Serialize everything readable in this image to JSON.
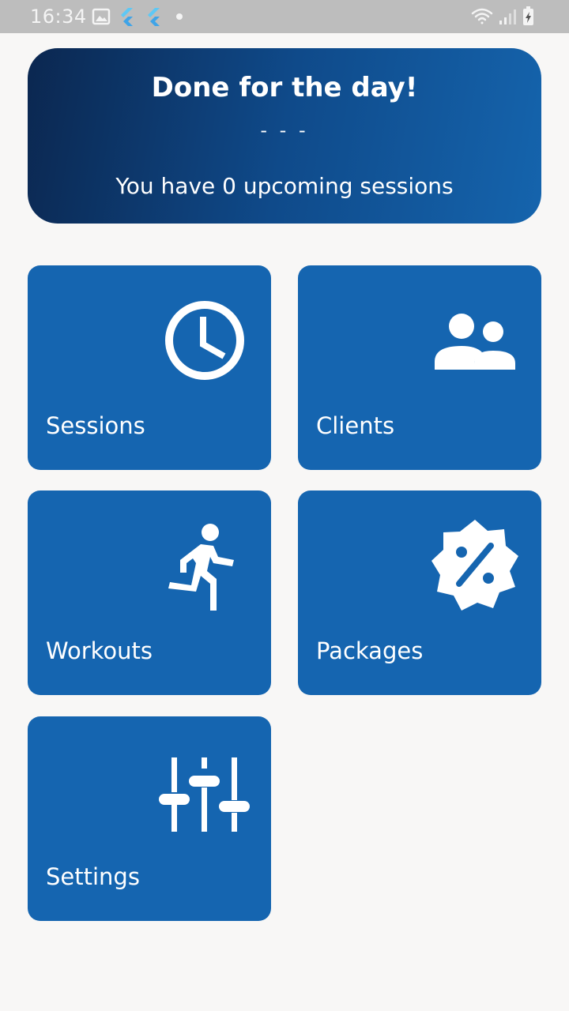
{
  "status_bar": {
    "time": "16:34",
    "icons_left": [
      "image-icon",
      "flutter-icon",
      "flutter-icon",
      "dot-icon"
    ],
    "icons_right": [
      "wifi-icon",
      "signal-icon",
      "battery-charging-icon"
    ]
  },
  "banner": {
    "title": "Done for the day!",
    "divider": "- - -",
    "subtitle": "You have 0 upcoming sessions"
  },
  "tiles": [
    {
      "label": "Sessions",
      "icon": "clock-icon"
    },
    {
      "label": "Clients",
      "icon": "people-icon"
    },
    {
      "label": "Workouts",
      "icon": "running-icon"
    },
    {
      "label": "Packages",
      "icon": "discount-badge-icon"
    },
    {
      "label": "Settings",
      "icon": "sliders-icon"
    }
  ],
  "colors": {
    "tile": "#1565b0",
    "banner_start": "#0b2750",
    "banner_end": "#1564ad",
    "background": "#f8f7f6"
  }
}
